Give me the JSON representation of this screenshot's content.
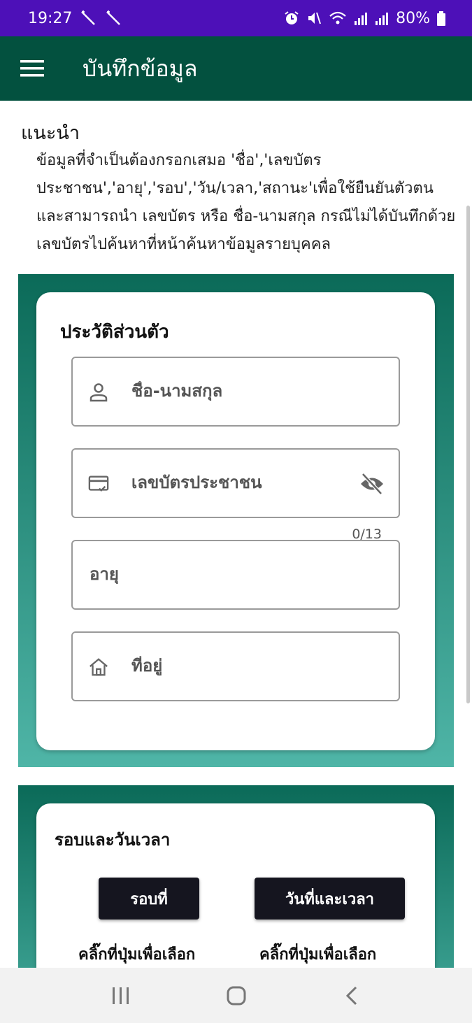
{
  "status_bar": {
    "time": "19:27",
    "battery": "80%",
    "icons": [
      "sparkle-icon",
      "sparkle-icon",
      "alarm-icon",
      "mute-icon",
      "wifi-icon",
      "signal-icon",
      "signal-icon",
      "battery-icon"
    ]
  },
  "app_bar": {
    "title": "บันทึกข้อมูล",
    "menu_icon": "hamburger-menu-icon"
  },
  "guide": {
    "title": "แนะนำ",
    "text": "ข้อมูลที่จำเป็นต้องกรอกเสมอ 'ชื่อ','เลขบัตรประชาชน','อายุ','รอบ','วัน/เวลา,'สถานะ'เพื่อใช้ยืนยันตัวตนและสามารถนำ เลขบัตร หรือ ชื่อ-นามสกุล กรณีไม่ได้บันทึกด้วยเลขบัตรไปค้นหาที่หน้าค้นหาข้อมูลรายบุคคล"
  },
  "personal": {
    "title": "ประวัติส่วนตัว",
    "name_placeholder": "ชื่อ-นามสกุล",
    "id_placeholder": "เลขบัตรประชาชน",
    "id_counter": "0/13",
    "age_placeholder": "อายุ",
    "address_placeholder": "ที่อยู่"
  },
  "schedule": {
    "title": "รอบและวันเวลา",
    "round_button": "รอบที่",
    "datetime_button": "วันที่และเวลา",
    "round_hint": "คลิ๊กที่ปุ่มเพื่อเลือก",
    "datetime_hint": "คลิ๊กที่ปุ่มเพื่อเลือก"
  },
  "colors": {
    "status_bar": "#4d10b8",
    "app_bar": "#03513f",
    "section_top": "#0b6a58",
    "section_bottom": "#4fb5a7",
    "button": "#15151f"
  }
}
